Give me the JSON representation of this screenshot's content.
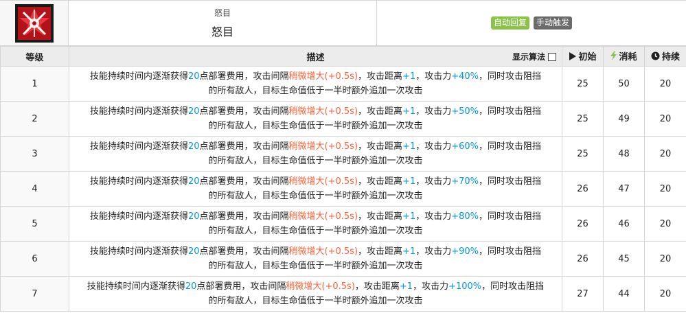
{
  "skill": {
    "name_small": "怒目",
    "name_big": "怒目",
    "tag_recovery": "自动回复",
    "tag_trigger": "手动触发"
  },
  "table": {
    "headers": {
      "level": "等级",
      "description": "描述",
      "show_formula": "显示算法",
      "initial": "初始",
      "cost": "消耗",
      "duration": "持续"
    },
    "desc_parts": {
      "p1": "技能持续时间内逐渐获得",
      "dp": "20",
      "p2": "点部署费用，攻击间隔",
      "interval": "稍微增大",
      "interval_val": "(+0.5s)",
      "p3": "，攻击距离",
      "range": "+1",
      "p4": "，攻击力",
      "p5": "，同时攻击阻挡",
      "line2": "的所有敌人，目标生命值低于一半时额外追加一次攻击"
    },
    "rows": [
      {
        "level": "1",
        "atk": "+40%",
        "initial": "25",
        "cost": "50",
        "duration": "20"
      },
      {
        "level": "2",
        "atk": "+50%",
        "initial": "25",
        "cost": "49",
        "duration": "20"
      },
      {
        "level": "3",
        "atk": "+60%",
        "initial": "25",
        "cost": "48",
        "duration": "20"
      },
      {
        "level": "4",
        "atk": "+70%",
        "initial": "26",
        "cost": "47",
        "duration": "20"
      },
      {
        "level": "5",
        "atk": "+80%",
        "initial": "26",
        "cost": "46",
        "duration": "20"
      },
      {
        "level": "6",
        "atk": "+90%",
        "initial": "26",
        "cost": "45",
        "duration": "20"
      },
      {
        "level": "7",
        "atk": "+100%",
        "initial": "27",
        "cost": "44",
        "duration": "20"
      }
    ]
  },
  "colors": {
    "blue": "#0098dc",
    "orange": "#ff6237",
    "tag_green": "#8bc34a",
    "tag_gray": "#6b6b6b",
    "cost_icon": "#8bc34a"
  },
  "icons": {
    "skill": "skill-icon",
    "initial": "play-icon",
    "cost": "lightning-icon",
    "duration": "clock-icon",
    "formula": "checkbox-icon"
  }
}
